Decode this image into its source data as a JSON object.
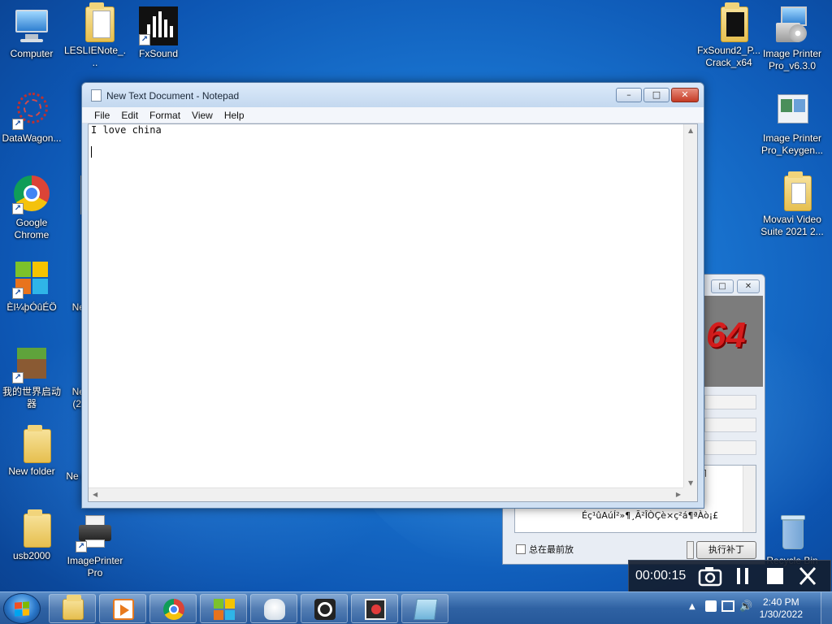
{
  "desktop": {
    "icons_left": [
      {
        "label": "Computer",
        "icon": "computer-icon"
      },
      {
        "label": "LESLIENote_...",
        "icon": "folder-icon"
      },
      {
        "label": "FxSound",
        "icon": "fxsound-icon"
      },
      {
        "label": "DataWagon...",
        "icon": "datawagon-icon"
      },
      {
        "label": "Google Chrome",
        "icon": "chrome-icon"
      },
      {
        "label": "ÈI¼þÓûÉÖ",
        "icon": "app-icon"
      },
      {
        "label": "我的世界启动器",
        "icon": "minecraft-icon"
      },
      {
        "label": "New folder",
        "icon": "folder-icon"
      },
      {
        "label": "usb2000",
        "icon": "folder-icon"
      },
      {
        "label": "ImagePrinter Pro",
        "icon": "printer-icon"
      }
    ],
    "partial_labels": [
      "Ne",
      "Ne (2)",
      "Ne ("
    ],
    "icons_right": [
      {
        "label": "FxSound2_P... Crack_x64",
        "icon": "folder-icon"
      },
      {
        "label": "Image Printer Pro_v6.3.0",
        "icon": "installer-icon"
      },
      {
        "label": "Image Printer Pro_Keygen...",
        "icon": "keygen-icon"
      },
      {
        "label": "Movavi Video Suite 2021 2...",
        "icon": "folder-icon"
      },
      {
        "label": "Recycle Bin",
        "icon": "recycle-bin-icon"
      }
    ]
  },
  "notepad": {
    "title": "New Text Document - Notepad",
    "menu": [
      "File",
      "Edit",
      "Format",
      "View",
      "Help"
    ],
    "content": "I love china",
    "min_label": "–",
    "max_label": "□",
    "close_label": "✕"
  },
  "background_dialog": {
    "banner_text": "64",
    "list_line1": "¶",
    "list_line2": "Éç¹ûAúÍ²»¶¸Ã²ÎÒÇè×ç²á¶ªÀò¡£",
    "checkbox_label": "总在最前放",
    "execute_button": "执行补丁"
  },
  "recorder": {
    "time": "00:00:15"
  },
  "taskbar": {
    "apps": [
      "file-explorer-icon",
      "media-player-icon",
      "chrome-icon",
      "app-tiles-icon",
      "robot-app-icon",
      "obs-icon",
      "screen-recorder-icon",
      "notepad-icon"
    ],
    "clock_time": "2:40 PM",
    "clock_date": "1/30/2022"
  },
  "colors": {
    "taskbar": "#2f62a3",
    "notepad_frame": "#cfe0f3",
    "close_button": "#c43b25"
  }
}
